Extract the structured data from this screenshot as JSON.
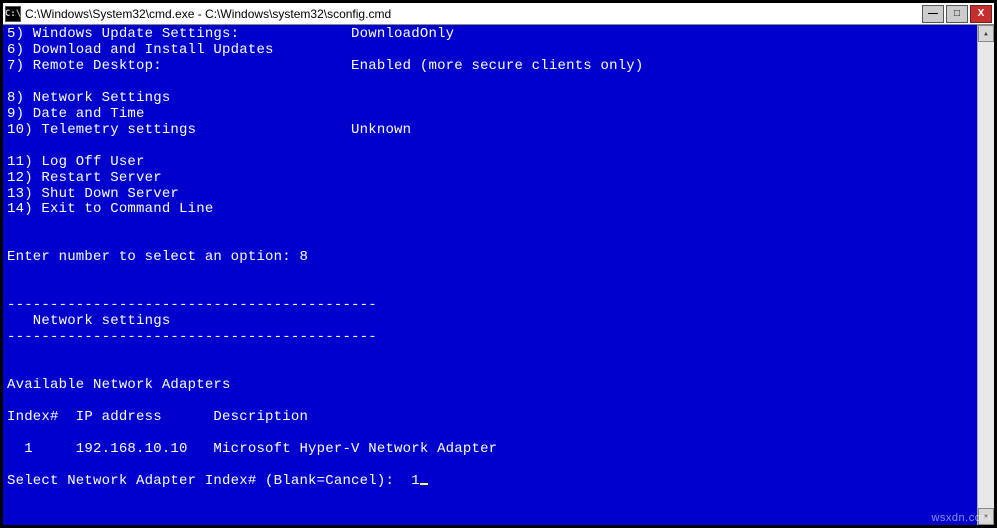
{
  "window": {
    "title": "C:\\Windows\\System32\\cmd.exe - C:\\Windows\\system32\\sconfig.cmd",
    "icon_label": "C:\\",
    "controls": {
      "minimize": "—",
      "maximize": "□",
      "close": "X"
    }
  },
  "menu": {
    "items": [
      {
        "num": "5",
        "label": "Windows Update Settings:",
        "value": "DownloadOnly"
      },
      {
        "num": "6",
        "label": "Download and Install Updates",
        "value": ""
      },
      {
        "num": "7",
        "label": "Remote Desktop:",
        "value": "Enabled (more secure clients only)"
      },
      {
        "num": "8",
        "label": "Network Settings",
        "value": ""
      },
      {
        "num": "9",
        "label": "Date and Time",
        "value": ""
      },
      {
        "num": "10",
        "label": "Telemetry settings",
        "value": "Unknown"
      },
      {
        "num": "11",
        "label": "Log Off User",
        "value": ""
      },
      {
        "num": "12",
        "label": "Restart Server",
        "value": ""
      },
      {
        "num": "13",
        "label": "Shut Down Server",
        "value": ""
      },
      {
        "num": "14",
        "label": "Exit to Command Line",
        "value": ""
      }
    ],
    "prompt_line": "Enter number to select an option: 8"
  },
  "section": {
    "dashes_top": "-------------------------------------------",
    "title": "   Network settings",
    "dashes_bottom": "-------------------------------------------"
  },
  "adapters": {
    "heading": "Available Network Adapters",
    "header": {
      "index": "Index#",
      "ip": "IP address",
      "desc": "Description"
    },
    "rows": [
      {
        "index": "1",
        "ip": "192.168.10.10",
        "desc": "Microsoft Hyper-V Network Adapter"
      }
    ]
  },
  "prompt2": {
    "text": "Select Network Adapter Index# (Blank=Cancel):  ",
    "value": "1"
  },
  "watermark": "wsxdn.com"
}
